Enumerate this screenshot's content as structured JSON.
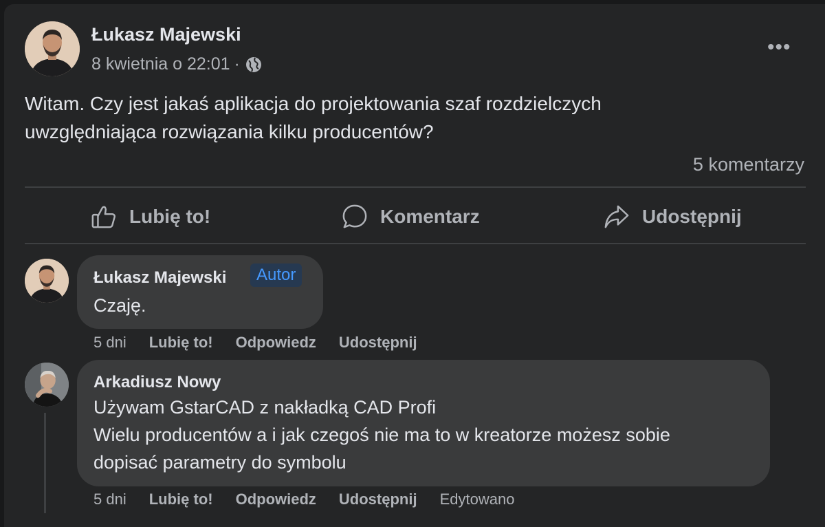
{
  "post": {
    "author": "Łukasz Majewski",
    "date": "8 kwietnia o 22:01",
    "separator": "·",
    "privacy_icon": "globe-icon",
    "more_label": "•••",
    "text_lines": [
      "Witam. Czy jest jakaś aplikacja do projektowania szaf rozdzielczych",
      "uwzględniająca rozwiązania kilku producentów?"
    ],
    "comment_count": "5 komentarzy"
  },
  "actions": {
    "like": "Lubię to!",
    "comment": "Komentarz",
    "share": "Udostępnij"
  },
  "comments": [
    {
      "author": "Łukasz Majewski",
      "badge": "Autor",
      "lines": [
        "Czaję."
      ],
      "time": "5 dni",
      "like": "Lubię to!",
      "reply": "Odpowiedz",
      "share": "Udostępnij",
      "edited": ""
    },
    {
      "author": "Arkadiusz Nowy",
      "badge": "",
      "lines": [
        "Używam GstarCAD z nakładką CAD Profi",
        "Wielu producentów a i jak czegoś nie ma to w kreatorze możesz sobie",
        "dopisać parametry do symbolu"
      ],
      "time": "5 dni",
      "like": "Lubię to!",
      "reply": "Odpowiedz",
      "share": "Udostępnij",
      "edited": "Edytowano"
    }
  ],
  "colors": {
    "background": "#18191a",
    "card": "#242526",
    "bubble": "#3a3b3c",
    "text_primary": "#e4e6eb",
    "text_secondary": "#b0b3b8",
    "badge_text": "#4599ff",
    "badge_bg": "#263951"
  }
}
